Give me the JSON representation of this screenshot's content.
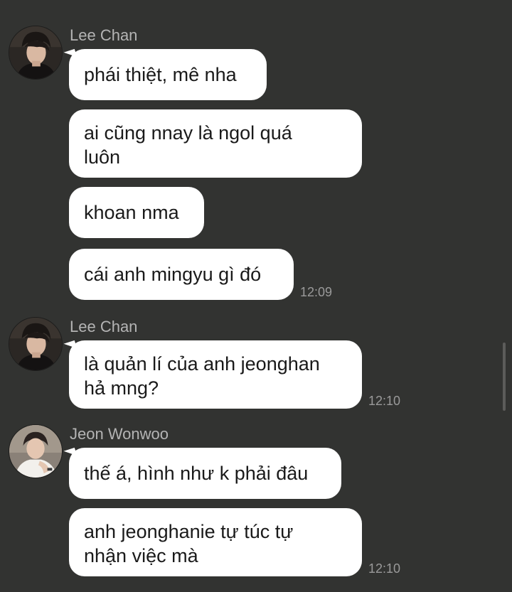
{
  "groups": [
    {
      "sender": "Lee Chan",
      "avatar_icon": "profile-photo",
      "messages": [
        {
          "lines": [
            "phái thiệt, mê nha"
          ]
        },
        {
          "lines": [
            "ai cũng nnay là ngol quá",
            "luôn"
          ]
        },
        {
          "lines": [
            "khoan nma"
          ]
        },
        {
          "lines": [
            "cái anh mingyu gì đó"
          ],
          "time": "12:09"
        }
      ]
    },
    {
      "sender": "Lee Chan",
      "avatar_icon": "profile-photo",
      "messages": [
        {
          "lines": [
            "là quản lí của anh jeonghan",
            "hả mng?"
          ],
          "time": "12:10"
        }
      ]
    },
    {
      "sender": "Jeon Wonwoo",
      "avatar_icon": "profile-photo",
      "messages": [
        {
          "lines": [
            "thế á, hình như k phải đâu"
          ]
        },
        {
          "lines": [
            "anh jeonghanie tự túc tự",
            "nhận việc mà"
          ],
          "time": "12:10"
        }
      ]
    }
  ],
  "colors": {
    "background": "#323331",
    "bubble": "#ffffff",
    "sender_name": "#b4b4b4",
    "timestamp": "#9a9a9a"
  }
}
